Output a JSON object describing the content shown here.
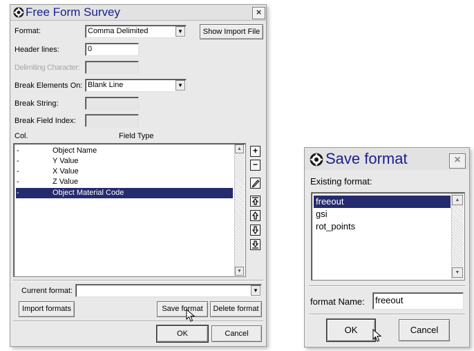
{
  "free_form_survey": {
    "title": "Free Form Survey",
    "close_label": "×",
    "format_label": "Format:",
    "format_value": "Comma Delimited",
    "show_import_file": "Show Import File",
    "header_lines_label": "Header lines:",
    "header_lines_value": "0",
    "delimiting_character_label": "Delimiting Character:",
    "break_elements_on_label": "Break Elements On:",
    "break_elements_on_value": "Blank Line",
    "break_string_label": "Break String:",
    "break_field_index_label": "Break Field Index:",
    "col_header": "Col.",
    "field_type_header": "Field Type",
    "fields": [
      {
        "col": "-",
        "type": "Object Name"
      },
      {
        "col": "-",
        "type": "Y Value"
      },
      {
        "col": "-",
        "type": "X Value"
      },
      {
        "col": "-",
        "type": "Z Value"
      },
      {
        "col": "-",
        "type": "Object Material Code"
      }
    ],
    "selected_field_index": 4,
    "current_format_label": "Current format:",
    "current_format_value": "",
    "import_formats": "Import formats",
    "save_format": "Save format",
    "delete_format": "Delete format",
    "ok": "OK",
    "cancel": "Cancel",
    "tool_icons": [
      "add-icon",
      "remove-icon",
      "edit-icon",
      "move-top-icon",
      "move-up-icon",
      "move-down-icon",
      "move-bottom-icon"
    ]
  },
  "save_format_dialog": {
    "title": "Save format",
    "close_label": "×",
    "existing_format_label": "Existing format:",
    "formats": [
      "freeout",
      "gsi",
      "rot_points"
    ],
    "selected_index": 0,
    "format_name_label": "format Name:",
    "format_name_value": "freeout",
    "ok": "OK",
    "cancel": "Cancel"
  },
  "colors": {
    "title_text": "#1a1f8a",
    "selection": "#242b6e",
    "dialog_bg": "#e9e9e9"
  }
}
